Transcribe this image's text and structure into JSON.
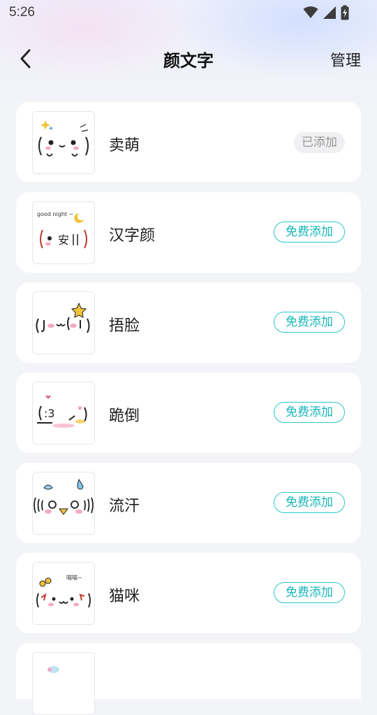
{
  "status_bar": {
    "time": "5:26",
    "icons": [
      "wifi-icon",
      "cellular-signal-icon",
      "battery-charging-icon"
    ]
  },
  "header": {
    "title": "颜文字",
    "manage_label": "管理",
    "back_icon": "chevron-left-icon"
  },
  "items": [
    {
      "name": "卖萌",
      "action_label": "已添加",
      "status": "added"
    },
    {
      "name": "汉字颜",
      "action_label": "免费添加",
      "status": "free"
    },
    {
      "name": "捂脸",
      "action_label": "免费添加",
      "status": "free"
    },
    {
      "name": "跪倒",
      "action_label": "免费添加",
      "status": "free"
    },
    {
      "name": "流汗",
      "action_label": "免费添加",
      "status": "free"
    },
    {
      "name": "猫咪",
      "action_label": "免费添加",
      "status": "free"
    }
  ],
  "thumb_text": {
    "hanzi_face": "安",
    "good_night": "good night ~"
  },
  "colors": {
    "accent": "#2bc6c9",
    "added_text": "#9a9a9a",
    "card_bg": "#ffffff",
    "page_bg": "#f3f4f8"
  }
}
